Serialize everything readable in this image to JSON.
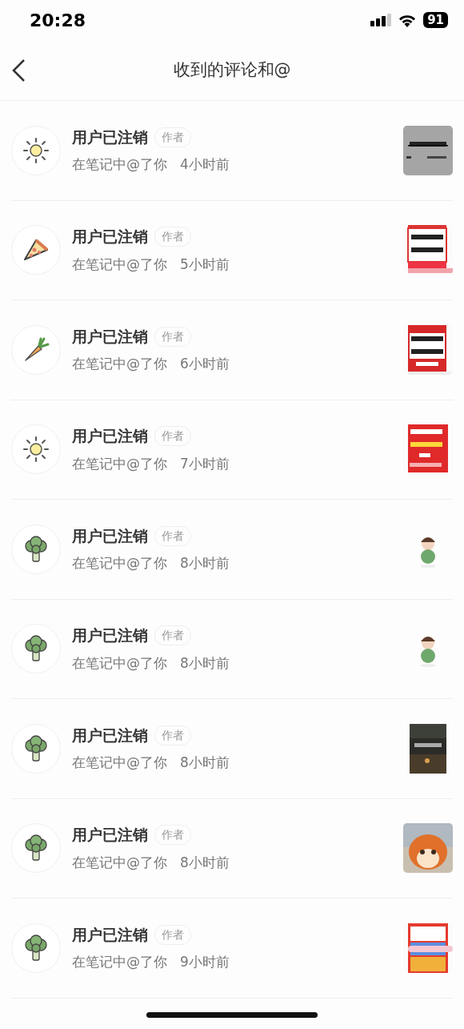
{
  "status_bar": {
    "time": "20:28",
    "battery": "91"
  },
  "header": {
    "title": "收到的评论和@"
  },
  "notifications": [
    {
      "kind": "sun",
      "name": "用户已注销",
      "tag": "作者",
      "action": "在笔记中@了你",
      "time": "4小时前"
    },
    {
      "kind": "pizza",
      "name": "用户已注销",
      "tag": "作者",
      "action": "在笔记中@了你",
      "time": "5小时前"
    },
    {
      "kind": "carrot",
      "name": "用户已注销",
      "tag": "作者",
      "action": "在笔记中@了你",
      "time": "6小时前"
    },
    {
      "kind": "sun",
      "name": "用户已注销",
      "tag": "作者",
      "action": "在笔记中@了你",
      "time": "7小时前"
    },
    {
      "kind": "broccoli",
      "name": "用户已注销",
      "tag": "作者",
      "action": "在笔记中@了你",
      "time": "8小时前"
    },
    {
      "kind": "broccoli",
      "name": "用户已注销",
      "tag": "作者",
      "action": "在笔记中@了你",
      "time": "8小时前"
    },
    {
      "kind": "broccoli",
      "name": "用户已注销",
      "tag": "作者",
      "action": "在笔记中@了你",
      "time": "8小时前"
    },
    {
      "kind": "broccoli",
      "name": "用户已注销",
      "tag": "作者",
      "action": "在笔记中@了你",
      "time": "8小时前"
    },
    {
      "kind": "broccoli",
      "name": "用户已注销",
      "tag": "作者",
      "action": "在笔记中@了你",
      "time": "9小时前"
    }
  ]
}
